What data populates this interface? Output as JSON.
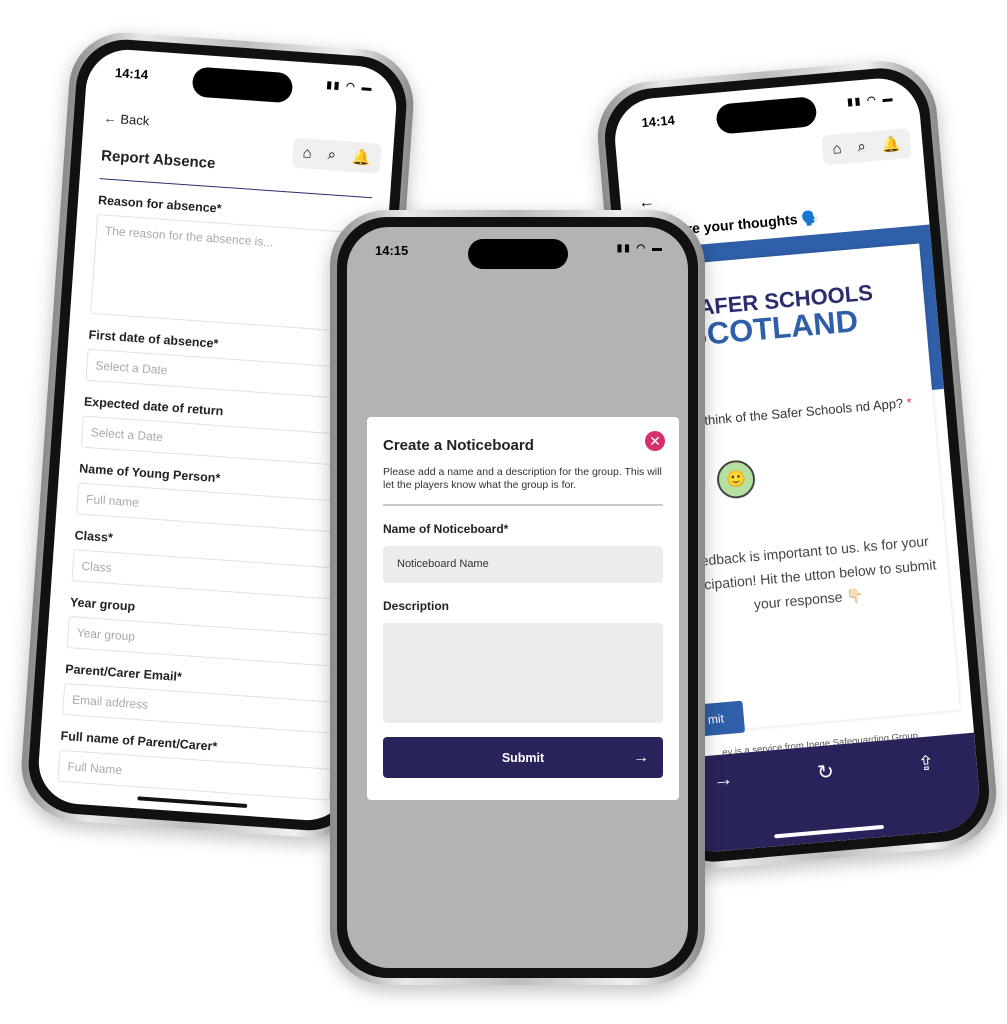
{
  "left_phone": {
    "time": "14:14",
    "back": "Back",
    "title": "Report Absence",
    "fields": [
      {
        "label": "Reason for absence*",
        "placeholder": "The reason for the absence is..."
      },
      {
        "label": "First date of absence*",
        "placeholder": "Select a Date"
      },
      {
        "label": "Expected date of return",
        "placeholder": "Select a Date"
      },
      {
        "label": "Name of Young Person*",
        "placeholder": "Full name"
      },
      {
        "label": "Class*",
        "placeholder": "Class"
      },
      {
        "label": "Year group",
        "placeholder": "Year group"
      },
      {
        "label": "Parent/Carer Email*",
        "placeholder": "Email address"
      },
      {
        "label": "Full name of Parent/Carer*",
        "placeholder": "Full Name"
      }
    ],
    "accent": "#2a2d6e"
  },
  "center_phone": {
    "time": "14:15",
    "modal": {
      "title": "Create a Noticeboard",
      "description": "Please add a name and a description for the group. This will let the players know what the group is for.",
      "name_label": "Name of Noticeboard*",
      "name_placeholder": "Noticeboard Name",
      "description_label": "Description",
      "submit": "Submit"
    },
    "colors": {
      "close": "#d6306f",
      "submit": "#29235c",
      "overlay": "#b3b3b3"
    }
  },
  "right_phone": {
    "time": "14:14",
    "title": "Share your thoughts 🗣️",
    "logo_line1": "SAFER SCHOOLS",
    "logo_line2": "SCOTLAND",
    "question": "do you think of the Safer Schools nd App?",
    "required": "*",
    "feedback": "r feedback is important to us. ks for your participation! Hit the utton below to submit your response 👇🏻",
    "submit": "mit",
    "footer": "ey is a service from Ineqe Safeguarding Group.",
    "colors": {
      "brand": "#2e5fa8",
      "navbar": "#29235c"
    }
  }
}
